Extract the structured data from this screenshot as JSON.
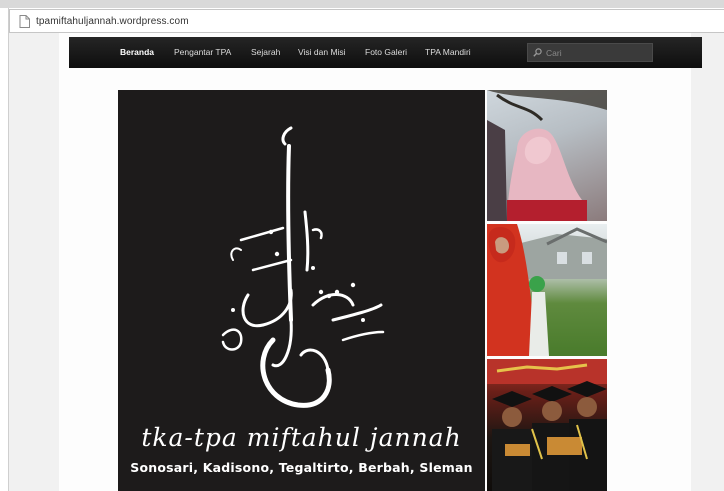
{
  "browser": {
    "url": "tpamiftahuljannah.wordpress.com"
  },
  "nav": {
    "items": [
      "Beranda",
      "Pengantar TPA",
      "Sejarah",
      "Visi dan Misi",
      "Foto Galeri",
      "TPA Mandiri"
    ],
    "active": "Beranda",
    "search_placeholder": "Cari"
  },
  "hero": {
    "title": "tka-tpa miftahul jannah",
    "subtitle": "Sonosari, Kadisono, Tegaltirto, Berbah, Sleman"
  },
  "colors": {
    "navbar": "#161616",
    "hero_background": "#1d1b1b",
    "page_background": "#f1f1f1"
  },
  "icons": [
    "page-icon",
    "search-icon"
  ]
}
